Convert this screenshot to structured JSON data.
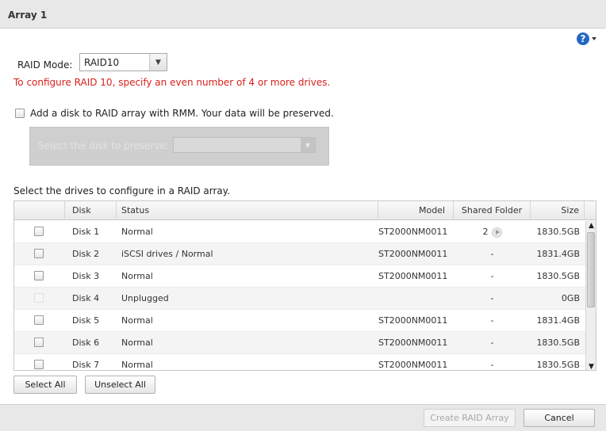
{
  "window": {
    "title": "Array 1"
  },
  "help": {
    "icon": "help-icon",
    "glyph": "?"
  },
  "raid_mode": {
    "label": "RAID Mode:",
    "value": "RAID10",
    "warning": "To configure RAID 10, specify an even number of 4 or more drives.",
    "warning_color": "#d8201c"
  },
  "rmm": {
    "label": "Add a disk to RAID array with RMM. Your data will be preserved.",
    "checked": false,
    "preserve_label": "Select the disk to preserve:",
    "preserve_value": ""
  },
  "drives": {
    "label": "Select the drives to configure in a RAID array.",
    "columns": [
      "",
      "Disk",
      "Status",
      "Model",
      "Shared Folder",
      "Size"
    ],
    "rows": [
      {
        "disk": "Disk 1",
        "status": "Normal",
        "model": "ST2000NM0011",
        "shared": "2",
        "size": "1830.5GB",
        "enabled": true,
        "has_link": true
      },
      {
        "disk": "Disk 2",
        "status": "iSCSI drives / Normal",
        "model": "ST2000NM0011",
        "shared": "-",
        "size": "1831.4GB",
        "enabled": true,
        "has_link": false
      },
      {
        "disk": "Disk 3",
        "status": "Normal",
        "model": "ST2000NM0011",
        "shared": "-",
        "size": "1830.5GB",
        "enabled": true,
        "has_link": false
      },
      {
        "disk": "Disk 4",
        "status": "Unplugged",
        "model": "",
        "shared": "-",
        "size": "0GB",
        "enabled": false,
        "has_link": false
      },
      {
        "disk": "Disk 5",
        "status": "Normal",
        "model": "ST2000NM0011",
        "shared": "-",
        "size": "1831.4GB",
        "enabled": true,
        "has_link": false
      },
      {
        "disk": "Disk 6",
        "status": "Normal",
        "model": "ST2000NM0011",
        "shared": "-",
        "size": "1830.5GB",
        "enabled": true,
        "has_link": false
      },
      {
        "disk": "Disk 7",
        "status": "Normal",
        "model": "ST2000NM0011",
        "shared": "-",
        "size": "1830.5GB",
        "enabled": true,
        "has_link": false
      }
    ]
  },
  "buttons": {
    "select_all": "Select All",
    "unselect_all": "Unselect All",
    "create": "Create RAID Array",
    "cancel": "Cancel"
  }
}
